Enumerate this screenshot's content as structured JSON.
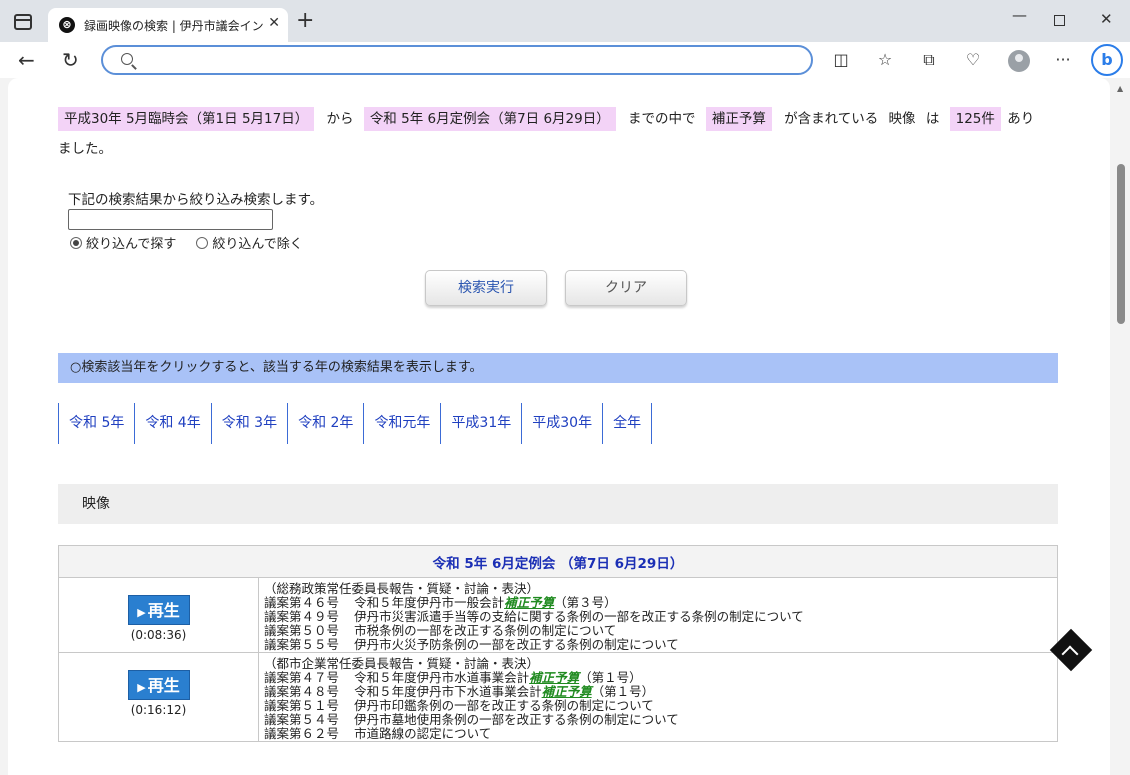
{
  "browser": {
    "tab_title": "録画映像の検索 | 伊丹市議会インタ",
    "tab_close": "✕",
    "new_tab": "+",
    "address_value": "",
    "icons": [
      "sidebar-icon",
      "back-icon",
      "reload-icon",
      "search-icon",
      "split-screen-icon",
      "favorites-icon",
      "collections-icon",
      "performance-icon",
      "profile-icon",
      "more-icon",
      "bing-icon"
    ]
  },
  "summary": {
    "range_start": "平成30年 5月臨時会（第1日 5月17日）",
    "from_text": "から",
    "range_end": "令和 5年 6月定例会（第7日 6月29日）",
    "between_text": "までの中で",
    "keyword": "補正予算",
    "contains_text": "が含まれている",
    "media_text": "映像",
    "ha_text": "は",
    "count": "125件",
    "arimashita_1": "あり",
    "arimashita_2": "ました。"
  },
  "filter": {
    "label": "下記の検索結果から絞り込み検索します。",
    "input_value": "",
    "radio_narrow": "絞り込んで探す",
    "radio_exclude": "絞り込んで除く",
    "search_button": "検索実行",
    "clear_button": "クリア"
  },
  "info_bar": "○検索該当年をクリックすると、該当する年の検索結果を表示します。",
  "year_tabs": [
    "令和 5年",
    "令和 4年",
    "令和 3年",
    "令和 2年",
    "令和元年",
    "平成31年",
    "平成30年",
    "全年"
  ],
  "section_title": "映像",
  "results": {
    "meeting_title": "令和 5年 6月定例会 （第7日 6月29日）",
    "play_label": "再生",
    "items": [
      {
        "time": "(0:08:36)",
        "committee": "（総務政策常任委員長報告・質疑・討論・表決）",
        "lines": [
          {
            "no": "議案第４６号",
            "pre": "令和５年度伊丹市一般会計",
            "kw": "補正予算",
            "post": "（第３号）"
          },
          {
            "no": "議案第４９号",
            "pre": "伊丹市災害派遣手当等の支給に関する条例の一部を改正する条例の制定について",
            "kw": "",
            "post": ""
          },
          {
            "no": "議案第５０号",
            "pre": "市税条例の一部を改正する条例の制定について",
            "kw": "",
            "post": ""
          },
          {
            "no": "議案第５５号",
            "pre": "伊丹市火災予防条例の一部を改正する条例の制定について",
            "kw": "",
            "post": ""
          }
        ]
      },
      {
        "time": "(0:16:12)",
        "committee": "（都市企業常任委員長報告・質疑・討論・表決）",
        "lines": [
          {
            "no": "議案第４７号",
            "pre": "令和５年度伊丹市水道事業会計",
            "kw": "補正予算",
            "post": "（第１号）"
          },
          {
            "no": "議案第４８号",
            "pre": "令和５年度伊丹市下水道事業会計",
            "kw": "補正予算",
            "post": "（第１号）"
          },
          {
            "no": "議案第５１号",
            "pre": "伊丹市印鑑条例の一部を改正する条例の制定について",
            "kw": "",
            "post": ""
          },
          {
            "no": "議案第５４号",
            "pre": "伊丹市墓地使用条例の一部を改正する条例の制定について",
            "kw": "",
            "post": ""
          },
          {
            "no": "議案第６２号",
            "pre": "市道路線の認定について",
            "kw": "",
            "post": ""
          }
        ]
      }
    ]
  },
  "colors": {
    "highlight": "#f3d3f7",
    "info_bar": "#a9c2f7",
    "play_button": "#2a7fd0",
    "keyword": "#1f8a1f",
    "meeting_title": "#1b2fb5"
  }
}
